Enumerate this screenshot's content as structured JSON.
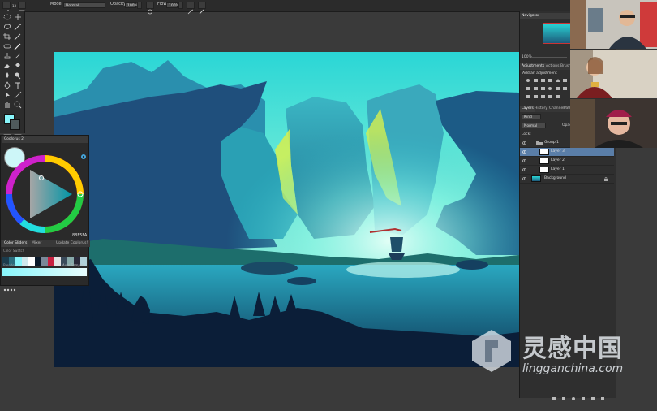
{
  "optionsBar": {
    "brushSize": "13",
    "modeLabel": "Mode:",
    "modeValue": "Normal",
    "opacityLabel": "Opacity:",
    "opacityValue": "100%",
    "flowLabel": "Flow:",
    "flowValue": "100%"
  },
  "coolorus": {
    "title": "Coolorus 2",
    "hexValue": "88F5FA",
    "tabs": [
      "Color Sliders",
      "Mixer"
    ],
    "updateLabel": "Update Coolorus!",
    "swatchHeader": "Color Swatch",
    "blenderLabel": "Blender",
    "autoSampleLabel": "Auto Sample",
    "accent": "#88F5FA"
  },
  "navigator": {
    "title": "Navigator",
    "zoom": "100%"
  },
  "adjustments": {
    "tabs": [
      "Adjustments",
      "Actions",
      "Brush"
    ],
    "addLabel": "Add an adjustment"
  },
  "layers": {
    "tabs": [
      "Layers",
      "History",
      "Channel",
      "Paths"
    ],
    "kindFilter": "Kind",
    "blendMode": "Normal",
    "opacityLabel": "Opaci",
    "lockLabel": "Lock:",
    "items": [
      {
        "name": "Group 1"
      },
      {
        "name": "Layer 3"
      },
      {
        "name": "Layer 2"
      },
      {
        "name": "Layer 1"
      },
      {
        "name": "Background"
      }
    ]
  },
  "watermark": {
    "name": "灵感中国",
    "url": "lingganchina.com"
  }
}
